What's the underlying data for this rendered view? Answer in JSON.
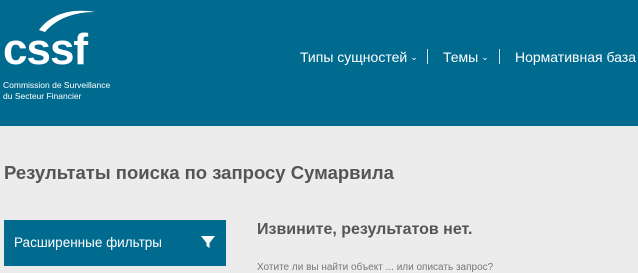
{
  "header": {
    "logo_text": "cssf",
    "logo_subtitle_line1": "Commission de Surveillance",
    "logo_subtitle_line2": "du Secteur Financier",
    "nav": [
      {
        "label": "Типы сущностей",
        "has_dropdown": true
      },
      {
        "label": "Темы",
        "has_dropdown": true
      },
      {
        "label": "Нормативная база",
        "has_dropdown": false
      }
    ]
  },
  "main": {
    "title": "Результаты поиска по запросу Сумарвила",
    "filters_button": "Расширенные фильтры",
    "no_results": "Извините, результатов нет.",
    "hint": "Хотите ли вы найти объект ... или описать запрос?"
  },
  "colors": {
    "brand": "#006b8f",
    "background": "#ececec",
    "text": "#555555"
  }
}
